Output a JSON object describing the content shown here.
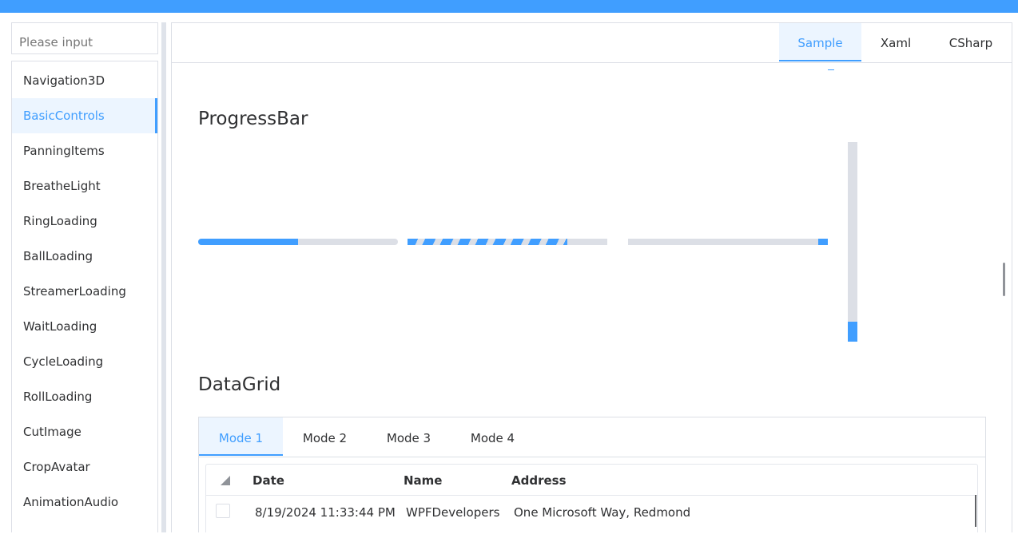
{
  "search": {
    "placeholder": "Please input"
  },
  "sidebar": {
    "items": [
      {
        "label": "Navigation3D"
      },
      {
        "label": "BasicControls",
        "active": true
      },
      {
        "label": "PanningItems"
      },
      {
        "label": "BreatheLight"
      },
      {
        "label": "RingLoading"
      },
      {
        "label": "BallLoading"
      },
      {
        "label": "StreamerLoading"
      },
      {
        "label": "WaitLoading"
      },
      {
        "label": "CycleLoading"
      },
      {
        "label": "RollLoading"
      },
      {
        "label": "CutImage"
      },
      {
        "label": "CropAvatar"
      },
      {
        "label": "AnimationAudio"
      }
    ]
  },
  "main": {
    "tabs": [
      {
        "label": "Sample",
        "active": true
      },
      {
        "label": "Xaml"
      },
      {
        "label": "CSharp"
      }
    ]
  },
  "progress": {
    "title": "ProgressBar",
    "bars": [
      {
        "value": 0.5,
        "style": "solid"
      },
      {
        "value": 0.8,
        "style": "striped-indeterminate"
      },
      {
        "value": 0.05,
        "style": "solid-end"
      }
    ],
    "vertical": {
      "value": 0.1
    }
  },
  "datagrid": {
    "title": "DataGrid",
    "tabs": [
      {
        "label": "Mode 1",
        "active": true
      },
      {
        "label": "Mode 2"
      },
      {
        "label": "Mode 3"
      },
      {
        "label": "Mode 4"
      }
    ],
    "columns": [
      "Date",
      "Name",
      "Address"
    ],
    "rows": [
      {
        "date": "8/19/2024 11:33:44 PM",
        "name": "WPFDevelopers",
        "address": "One Microsoft Way, Redmond"
      }
    ]
  },
  "colors": {
    "accent": "#409eff",
    "track": "#dcdfe6",
    "titlebar": "#409eff"
  }
}
